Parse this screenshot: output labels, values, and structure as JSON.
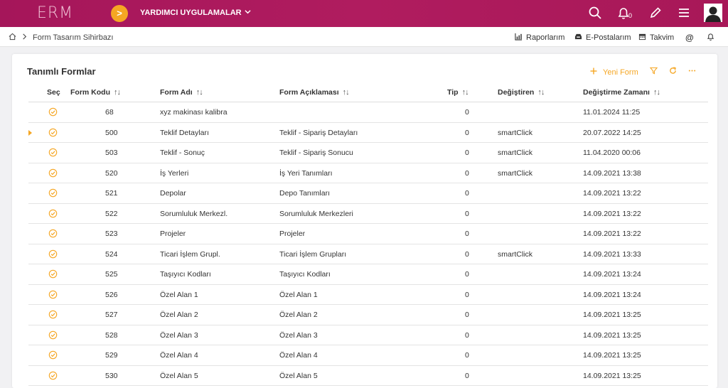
{
  "header": {
    "logo": "ERM",
    "apps_menu": "YARDIMCI UYGULAMALAR",
    "notification_count": "0"
  },
  "breadcrumb": {
    "page": "Form Tasarım Sihirbazı"
  },
  "quick_links": {
    "reports": "Raporlarım",
    "emails": "E-Postalarım",
    "calendar": "Takvim"
  },
  "card": {
    "title": "Tanımlı Formlar",
    "new_form": "Yeni Form"
  },
  "table": {
    "columns": {
      "select": "Seç",
      "code": "Form Kodu",
      "name": "Form Adı",
      "desc": "Form Açıklaması",
      "type": "Tip",
      "changer": "Değiştiren",
      "changed_at": "Değiştirme Zamanı"
    },
    "rows": [
      {
        "code": "68",
        "name": "xyz makinası kalibra",
        "desc": "",
        "type": "0",
        "changer": "",
        "changed_at": "11.01.2024 11:25"
      },
      {
        "code": "500",
        "name": "Teklif Detayları",
        "desc": "Teklif - Sipariş Detayları",
        "type": "0",
        "changer": "smartClick",
        "changed_at": "20.07.2022 14:25"
      },
      {
        "code": "503",
        "name": "Teklif - Sonuç",
        "desc": "Teklif - Sipariş Sonucu",
        "type": "0",
        "changer": "smartClick",
        "changed_at": "11.04.2020 00:06"
      },
      {
        "code": "520",
        "name": "İş Yerleri",
        "desc": "İş Yeri Tanımları",
        "type": "0",
        "changer": "smartClick",
        "changed_at": "14.09.2021 13:38"
      },
      {
        "code": "521",
        "name": "Depolar",
        "desc": "Depo Tanımları",
        "type": "0",
        "changer": "",
        "changed_at": "14.09.2021 13:22"
      },
      {
        "code": "522",
        "name": "Sorumluluk Merkezl.",
        "desc": "Sorumluluk Merkezleri",
        "type": "0",
        "changer": "",
        "changed_at": "14.09.2021 13:22"
      },
      {
        "code": "523",
        "name": "Projeler",
        "desc": "Projeler",
        "type": "0",
        "changer": "",
        "changed_at": "14.09.2021 13:22"
      },
      {
        "code": "524",
        "name": "Ticari İşlem Grupl.",
        "desc": "Ticari İşlem Grupları",
        "type": "0",
        "changer": "smartClick",
        "changed_at": "14.09.2021 13:33"
      },
      {
        "code": "525",
        "name": "Taşıyıcı Kodları",
        "desc": "Taşıyıcı Kodları",
        "type": "0",
        "changer": "",
        "changed_at": "14.09.2021 13:24"
      },
      {
        "code": "526",
        "name": "Özel Alan 1",
        "desc": "Özel Alan 1",
        "type": "0",
        "changer": "",
        "changed_at": "14.09.2021 13:24"
      },
      {
        "code": "527",
        "name": "Özel Alan 2",
        "desc": "Özel Alan 2",
        "type": "0",
        "changer": "",
        "changed_at": "14.09.2021 13:25"
      },
      {
        "code": "528",
        "name": "Özel Alan 3",
        "desc": "Özel Alan 3",
        "type": "0",
        "changer": "",
        "changed_at": "14.09.2021 13:25"
      },
      {
        "code": "529",
        "name": "Özel Alan 4",
        "desc": "Özel Alan 4",
        "type": "0",
        "changer": "",
        "changed_at": "14.09.2021 13:25"
      },
      {
        "code": "530",
        "name": "Özel Alan 5",
        "desc": "Özel Alan 5",
        "type": "0",
        "changer": "",
        "changed_at": "14.09.2021 13:25"
      }
    ]
  },
  "colors": {
    "brand": "#a5165a",
    "accent": "#f5a623"
  }
}
